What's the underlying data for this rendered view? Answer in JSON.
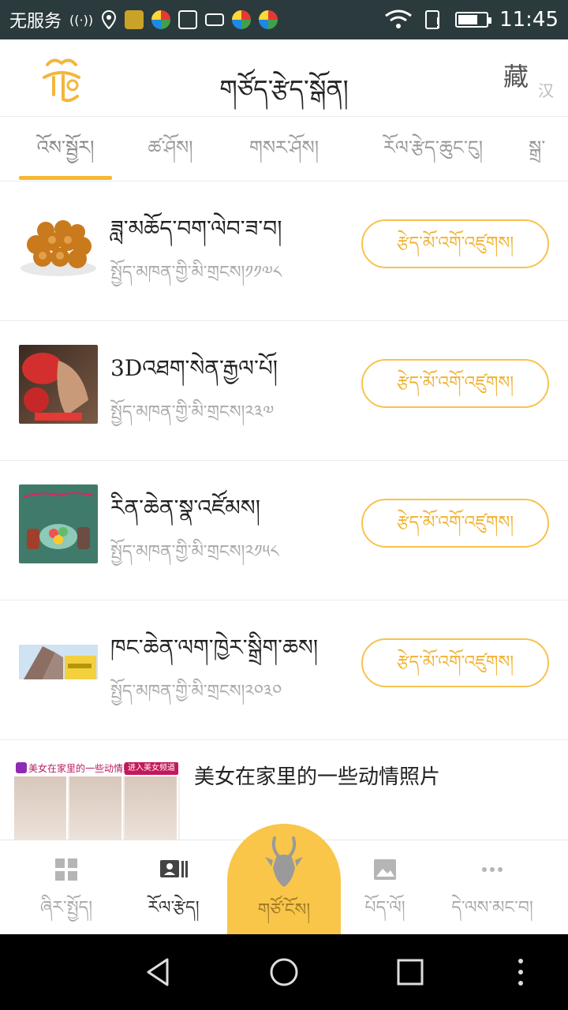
{
  "status_bar": {
    "carrier": "无服务",
    "time": "11:45",
    "battery_level": 0.7
  },
  "header": {
    "title": "གཙོད་རྩེད་སྒོན།",
    "lang_primary": "藏",
    "lang_secondary": "汉"
  },
  "tabs": [
    {
      "label": "འོས་སྦྱོར།",
      "active": true
    },
    {
      "label": "ཚ་ཤོས།",
      "active": false
    },
    {
      "label": "གསར་ཤོས།",
      "active": false
    },
    {
      "label": "རོལ་རྩེད་ཆུང་ངུ།",
      "active": false
    },
    {
      "label": "སྒྲ་",
      "active": false
    }
  ],
  "games": [
    {
      "title": "ཟླ་མཆོད་བག་ལེབ་ཟ་བ།",
      "subtitle": "སྤྱོད་མཁན་གྱི་མི་གྲངས།༡༡༧༨",
      "button": "རྩེད་མོ་འགོ་འཛུགས།",
      "thumb": "mooncake"
    },
    {
      "title": "3Dའཐག་སེན་རྒྱལ་པོ།",
      "subtitle": "སྤྱོད་མཁན་གྱི་མི་གྲངས།༢༣༧",
      "button": "རྩེད་མོ་འགོ་འཛུགས།",
      "thumb": "boxing"
    },
    {
      "title": "རིན་ཆེན་སྣ་འཛོམས།",
      "subtitle": "སྤྱོད་མཁན་གྱི་མི་གྲངས།༢༡༥༨",
      "button": "རྩེད་མོ་འགོ་འཛུགས།",
      "thumb": "jewels"
    },
    {
      "title": "ཁང་ཆེན་ལག་ཁྱེར་སྒྲིག་ཆས།",
      "subtitle": "སྤྱོད་མཁན་གྱི་མི་གྲངས།༢༠༣༠",
      "button": "རྩེད་མོ་འགོ་འཛུགས།",
      "thumb": "building"
    }
  ],
  "ad": {
    "banner_text": "美女在家里的一些动情照片",
    "banner_tag": "进入美女频道",
    "title": "美女在家里的一些动情照片"
  },
  "bottom_nav": [
    {
      "label": "ཞིར་སྤྱོད།",
      "icon": "grid-icon",
      "active": false
    },
    {
      "label": "རོལ་རྩེད།",
      "icon": "id-card-icon",
      "active": true
    },
    {
      "label": "གཙོ་ངོས།",
      "icon": "antelope-icon",
      "active": false,
      "center": true
    },
    {
      "label": "པོད་ལོ།",
      "icon": "image-icon",
      "active": false
    },
    {
      "label": "དེ་ལས་མང་བ།",
      "icon": "more-icon",
      "active": false
    }
  ],
  "colors": {
    "accent": "#f7b733",
    "button_border": "#f7c24f",
    "status_bar": "#2b3a3d"
  }
}
